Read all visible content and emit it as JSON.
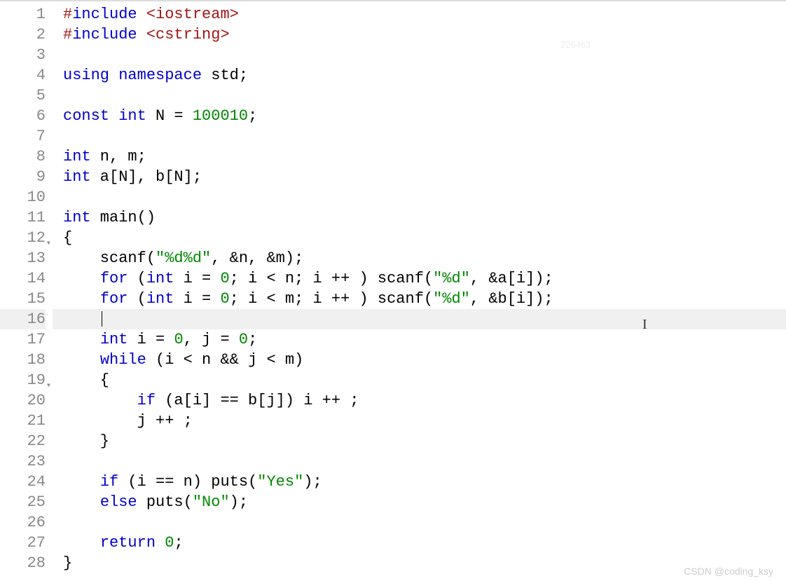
{
  "editor": {
    "highlighted_line": 16,
    "fold_lines": [
      12,
      19
    ],
    "line_count": 28,
    "lines": {
      "1": [
        {
          "c": "tok-preproc-hash",
          "t": "#"
        },
        {
          "c": "tok-dir",
          "t": "include"
        },
        {
          "c": "tok-plain",
          "t": " "
        },
        {
          "c": "tok-angled",
          "t": "<iostream>"
        }
      ],
      "2": [
        {
          "c": "tok-preproc-hash",
          "t": "#"
        },
        {
          "c": "tok-dir",
          "t": "include"
        },
        {
          "c": "tok-plain",
          "t": " "
        },
        {
          "c": "tok-angled",
          "t": "<cstring>"
        }
      ],
      "3": [],
      "4": [
        {
          "c": "tok-keyword",
          "t": "using"
        },
        {
          "c": "tok-plain",
          "t": " "
        },
        {
          "c": "tok-keyword",
          "t": "namespace"
        },
        {
          "c": "tok-plain",
          "t": " std;"
        }
      ],
      "5": [],
      "6": [
        {
          "c": "tok-keyword",
          "t": "const"
        },
        {
          "c": "tok-plain",
          "t": " "
        },
        {
          "c": "tok-type",
          "t": "int"
        },
        {
          "c": "tok-plain",
          "t": " N = "
        },
        {
          "c": "tok-number",
          "t": "100010"
        },
        {
          "c": "tok-plain",
          "t": ";"
        }
      ],
      "7": [],
      "8": [
        {
          "c": "tok-type",
          "t": "int"
        },
        {
          "c": "tok-plain",
          "t": " n, m;"
        }
      ],
      "9": [
        {
          "c": "tok-type",
          "t": "int"
        },
        {
          "c": "tok-plain",
          "t": " a[N], b[N];"
        }
      ],
      "10": [],
      "11": [
        {
          "c": "tok-type",
          "t": "int"
        },
        {
          "c": "tok-plain",
          "t": " main()"
        }
      ],
      "12": [
        {
          "c": "tok-plain",
          "t": "{"
        }
      ],
      "13": [
        {
          "c": "tok-plain",
          "t": "    scanf("
        },
        {
          "c": "tok-string",
          "t": "\"%d%d\""
        },
        {
          "c": "tok-plain",
          "t": ", &n, &m);"
        }
      ],
      "14": [
        {
          "c": "tok-plain",
          "t": "    "
        },
        {
          "c": "tok-keyword",
          "t": "for"
        },
        {
          "c": "tok-plain",
          "t": " ("
        },
        {
          "c": "tok-type",
          "t": "int"
        },
        {
          "c": "tok-plain",
          "t": " i = "
        },
        {
          "c": "tok-number",
          "t": "0"
        },
        {
          "c": "tok-plain",
          "t": "; i < n; i ++ ) scanf("
        },
        {
          "c": "tok-string",
          "t": "\"%d\""
        },
        {
          "c": "tok-plain",
          "t": ", &a[i]);"
        }
      ],
      "15": [
        {
          "c": "tok-plain",
          "t": "    "
        },
        {
          "c": "tok-keyword",
          "t": "for"
        },
        {
          "c": "tok-plain",
          "t": " ("
        },
        {
          "c": "tok-type",
          "t": "int"
        },
        {
          "c": "tok-plain",
          "t": " i = "
        },
        {
          "c": "tok-number",
          "t": "0"
        },
        {
          "c": "tok-plain",
          "t": "; i < m; i ++ ) scanf("
        },
        {
          "c": "tok-string",
          "t": "\"%d\""
        },
        {
          "c": "tok-plain",
          "t": ", &b[i]);"
        }
      ],
      "16": [
        {
          "c": "tok-plain",
          "t": "    "
        }
      ],
      "17": [
        {
          "c": "tok-plain",
          "t": "    "
        },
        {
          "c": "tok-type",
          "t": "int"
        },
        {
          "c": "tok-plain",
          "t": " i = "
        },
        {
          "c": "tok-number",
          "t": "0"
        },
        {
          "c": "tok-plain",
          "t": ", j = "
        },
        {
          "c": "tok-number",
          "t": "0"
        },
        {
          "c": "tok-plain",
          "t": ";"
        }
      ],
      "18": [
        {
          "c": "tok-plain",
          "t": "    "
        },
        {
          "c": "tok-keyword",
          "t": "while"
        },
        {
          "c": "tok-plain",
          "t": " (i < n && j < m)"
        }
      ],
      "19": [
        {
          "c": "tok-plain",
          "t": "    {"
        }
      ],
      "20": [
        {
          "c": "tok-plain",
          "t": "        "
        },
        {
          "c": "tok-keyword",
          "t": "if"
        },
        {
          "c": "tok-plain",
          "t": " (a[i] == b[j]) i ++ ;"
        }
      ],
      "21": [
        {
          "c": "tok-plain",
          "t": "        j ++ ;"
        }
      ],
      "22": [
        {
          "c": "tok-plain",
          "t": "    }"
        }
      ],
      "23": [],
      "24": [
        {
          "c": "tok-plain",
          "t": "    "
        },
        {
          "c": "tok-keyword",
          "t": "if"
        },
        {
          "c": "tok-plain",
          "t": " (i == n) puts("
        },
        {
          "c": "tok-string",
          "t": "\"Yes\""
        },
        {
          "c": "tok-plain",
          "t": ");"
        }
      ],
      "25": [
        {
          "c": "tok-plain",
          "t": "    "
        },
        {
          "c": "tok-keyword",
          "t": "else"
        },
        {
          "c": "tok-plain",
          "t": " puts("
        },
        {
          "c": "tok-string",
          "t": "\"No\""
        },
        {
          "c": "tok-plain",
          "t": ");"
        }
      ],
      "26": [],
      "27": [
        {
          "c": "tok-plain",
          "t": "    "
        },
        {
          "c": "tok-keyword",
          "t": "return"
        },
        {
          "c": "tok-plain",
          "t": " "
        },
        {
          "c": "tok-number",
          "t": "0"
        },
        {
          "c": "tok-plain",
          "t": ";"
        }
      ],
      "28": [
        {
          "c": "tok-plain",
          "t": "}"
        }
      ]
    }
  },
  "watermark": "CSDN @coding_ksy",
  "watermark_faint": "226463",
  "cursor_glyph": "I"
}
